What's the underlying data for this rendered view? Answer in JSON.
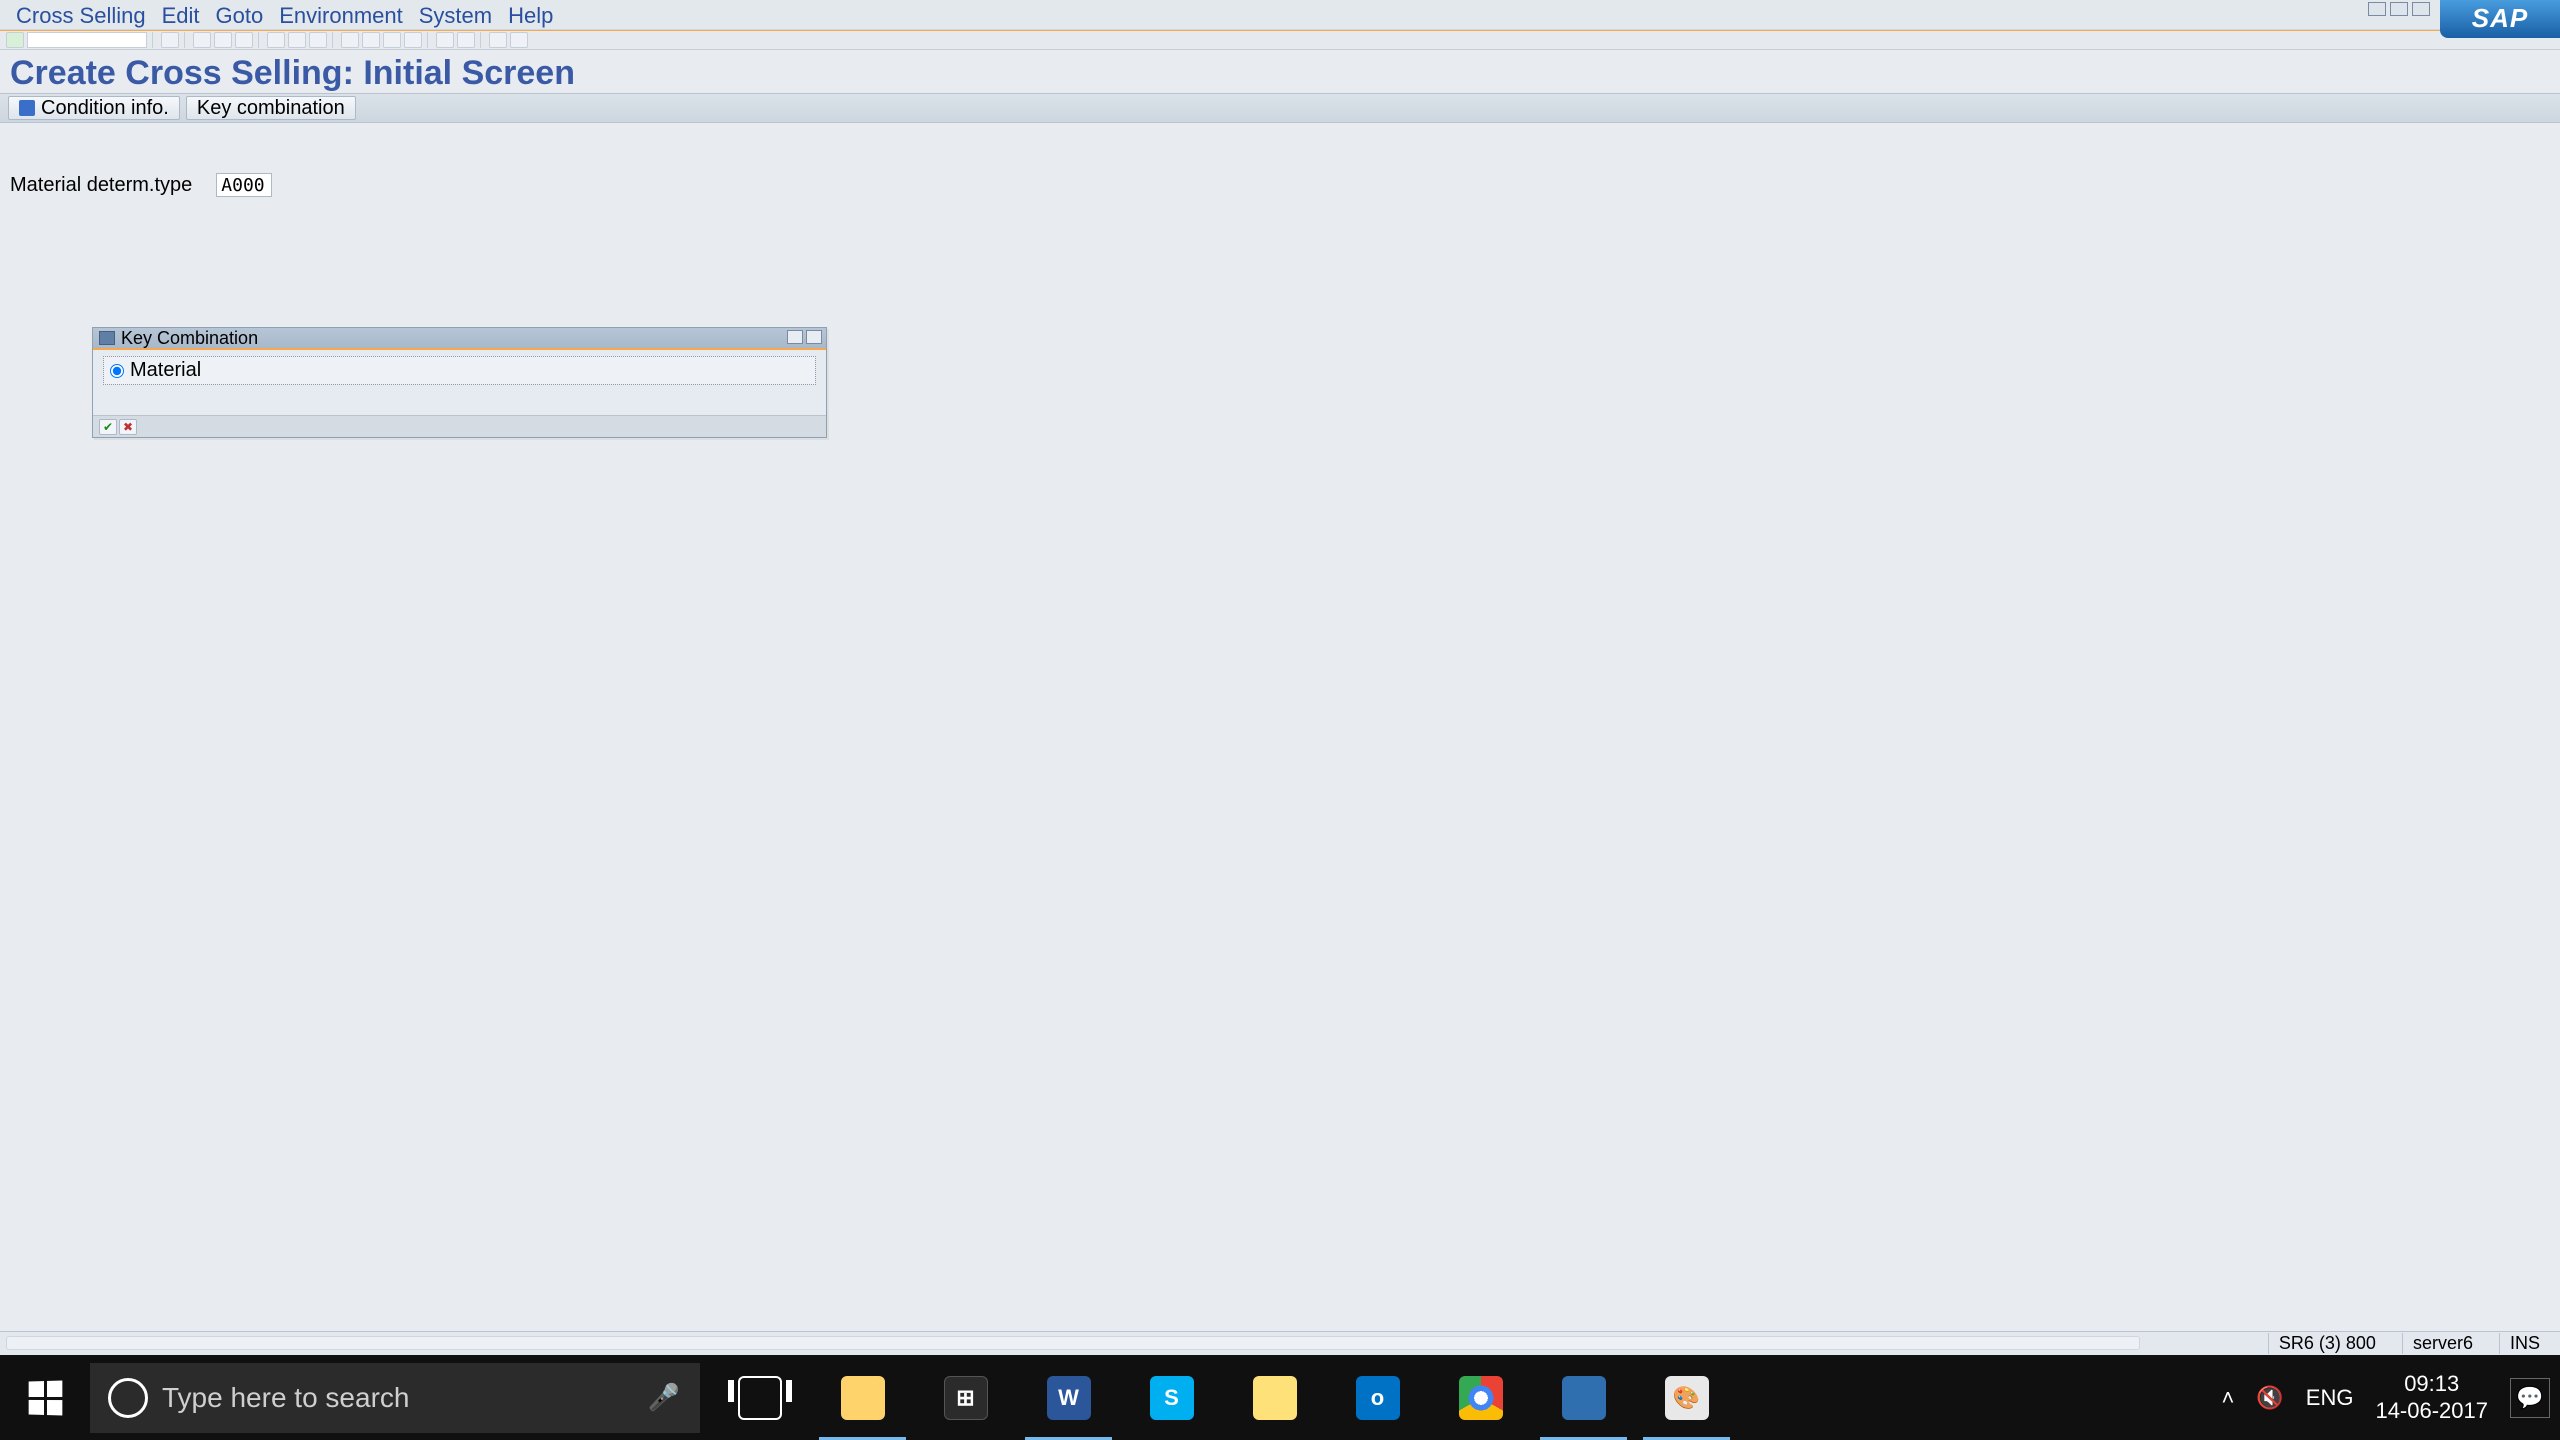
{
  "menubar": {
    "items": [
      "Cross Selling",
      "Edit",
      "Goto",
      "Environment",
      "System",
      "Help"
    ]
  },
  "sap_logo": "SAP",
  "page_title": "Create Cross Selling: Initial Screen",
  "app_toolbar": {
    "condition_info": "Condition info.",
    "key_combination": "Key combination"
  },
  "field": {
    "label": "Material determ.type",
    "value": "A000"
  },
  "dialog": {
    "title": "Key Combination",
    "option_material": "Material"
  },
  "statusbar": {
    "system": "SR6 (3) 800",
    "server": "server6",
    "mode": "INS"
  },
  "taskbar": {
    "search_placeholder": "Type here to search",
    "lang": "ENG",
    "time": "09:13",
    "date": "14-06-2017",
    "apps": {
      "word": "W",
      "skype": "S",
      "outlook": "o",
      "store": "⊞",
      "paint": "🎨"
    }
  }
}
